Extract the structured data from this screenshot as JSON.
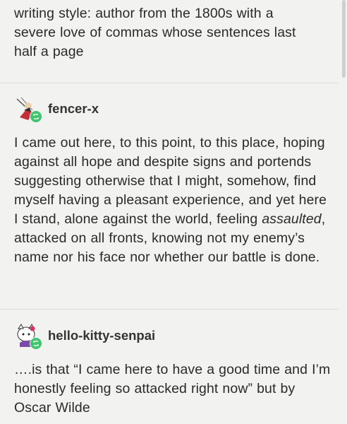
{
  "original_post": {
    "text_lines": [
      "writing style: author from the 1800s with a",
      "severe love of commas whose sentences last",
      "half a page"
    ]
  },
  "reblogs": [
    {
      "username": "fencer-x",
      "avatar": "fencer-avatar-icon",
      "text_before_italic": "I came out here, to this point, to this place, hoping against all hope and despite signs and portends suggesting otherwise that I might, somehow, find myself having a pleasant experience, and yet here I stand, alone against the world, feeling ",
      "italic_word": "assaulted",
      "text_after_italic": ", attacked on all fronts, knowing not my enemy’s name nor his face nor whether our battle is done."
    },
    {
      "username": "hello-kitty-senpai",
      "avatar": "hello-kitty-avatar-icon",
      "text": "….is that “I came here to have a good time and I’m honestly feeling so attacked right now” but by Oscar Wilde"
    }
  ],
  "colors": {
    "background": "#f2f2f0",
    "text": "#2a2a2a",
    "reblog_badge": "#3ec56e",
    "divider": "#dcdcd8"
  }
}
